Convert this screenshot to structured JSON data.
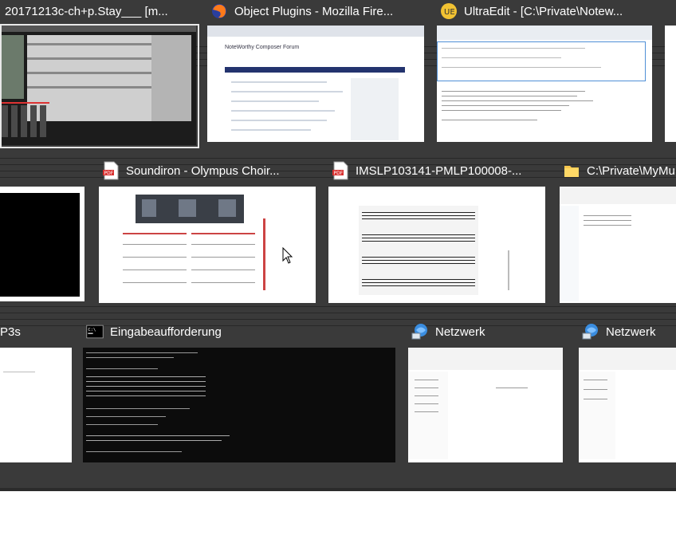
{
  "windows": [
    {
      "title": "20171213c-ch+p.Stay___ [m...",
      "icon": "daw-icon"
    },
    {
      "title": "Object Plugins - Mozilla Fire...",
      "icon": "firefox-icon"
    },
    {
      "title": "UltraEdit - [C:\\Private\\Notew...",
      "icon": "ultraedit-icon"
    },
    {
      "title": "Soundiron - Olympus Choir...",
      "icon": "pdf-icon"
    },
    {
      "title": "IMSLP103141-PMLP100008-...",
      "icon": "pdf-icon"
    },
    {
      "title": "C:\\Private\\MyMu",
      "icon": "folder-icon"
    },
    {
      "title": "P3s",
      "icon": "none"
    },
    {
      "title": "Eingabeaufforderung",
      "icon": "cmd-icon"
    },
    {
      "title": "Netzwerk",
      "icon": "network-icon"
    },
    {
      "title": "Netzwerk",
      "icon": "network-icon"
    }
  ],
  "firefox_page": {
    "heading": "NoteWorthy Composer Forum"
  },
  "colors": {
    "backdrop": "#3a3a3a",
    "selection": "#e8e8e8",
    "title_text": "#ffffff"
  }
}
